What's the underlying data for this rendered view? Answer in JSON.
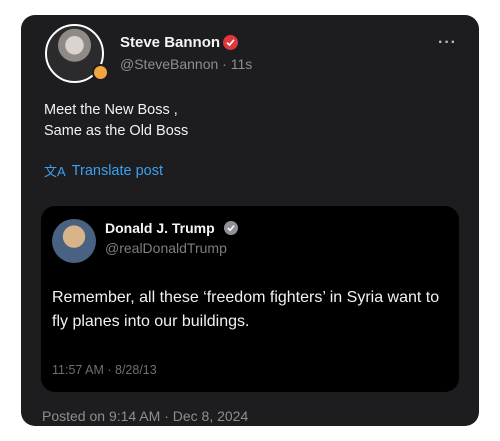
{
  "post": {
    "author_name": "Steve Bannon",
    "author_handle": "@SteveBannon · 11s",
    "more_label": "···",
    "text_line1": "Meet the New Boss ,",
    "text_line2": "Same as the Old Boss",
    "translate_label": "Translate post",
    "posted_on": "Posted on 9:14 AM · Dec 8, 2024"
  },
  "quote": {
    "author_name": "Donald J. Trump",
    "author_handle": "@realDonaldTrump",
    "text": "Remember, all these ‘freedom fighters’ in Syria want to fly planes into our buildings.",
    "timestamp": "11:57 AM · 8/28/13"
  },
  "colors": {
    "card_bg": "#1d1d1f",
    "quote_bg": "#000000",
    "link_blue": "#3aa0f0",
    "verified_red": "#e0373b",
    "verified_gray": "#8f9196"
  },
  "icons": {
    "author_verified": "verified-badge-icon",
    "quote_verified": "verified-badge-icon",
    "translate": "translate-icon",
    "more": "more-options-icon"
  }
}
